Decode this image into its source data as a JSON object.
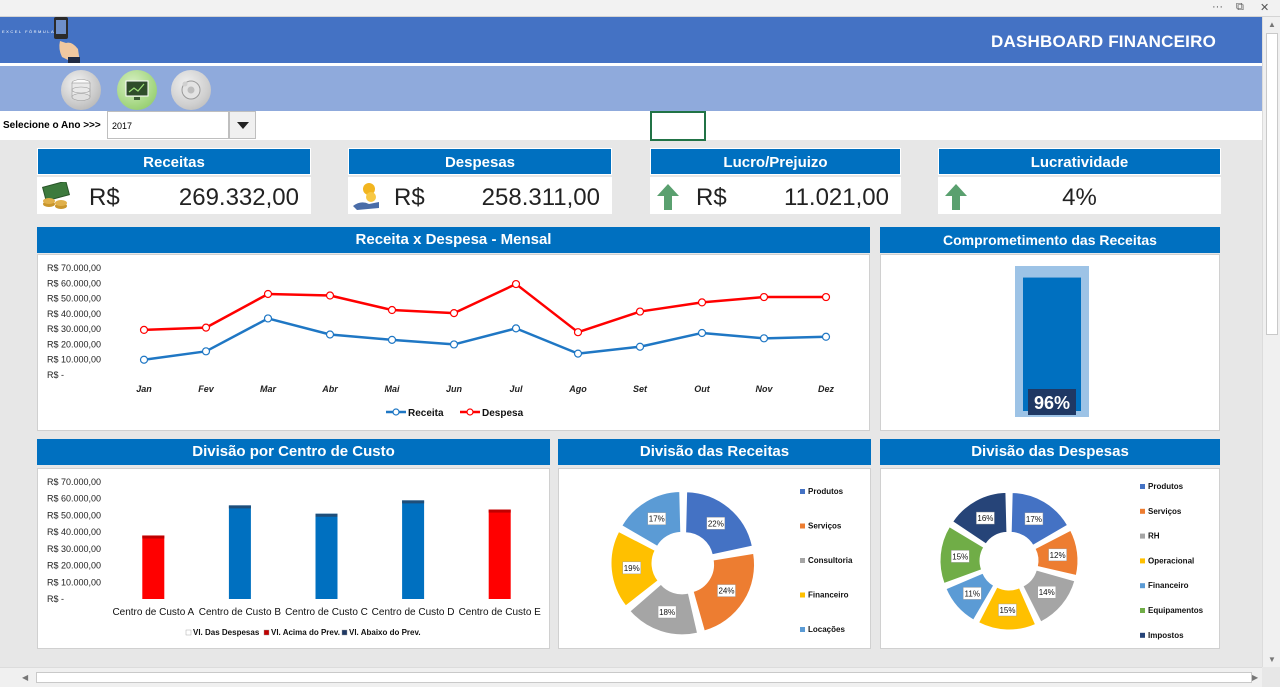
{
  "header": {
    "title": "DASHBOARD FINANCEIRO",
    "logo_text": "EXCEL FÓRMULA"
  },
  "year_filter": {
    "label": "Selecione o Ano >>>",
    "value": "2017"
  },
  "kpis": [
    {
      "title": "Receitas",
      "currency": "R$",
      "value": "269.332,00",
      "icon": "money-stack-icon"
    },
    {
      "title": "Despesas",
      "currency": "R$",
      "value": "258.311,00",
      "icon": "hand-coins-icon"
    },
    {
      "title": "Lucro/Prejuizo",
      "currency": "R$",
      "value": "11.021,00",
      "icon": "arrow-up-icon"
    },
    {
      "title": "Lucratividade",
      "value": "4%",
      "icon": "arrow-up-icon"
    }
  ],
  "colors": {
    "header_blue": "#4472c4",
    "panel_blue": "#0070c0",
    "strip_blue": "#8faadc",
    "receita_line": "#1f77c4",
    "despesa_line": "#ff0000",
    "up_arrow": "#5aa06f"
  },
  "panels": {
    "line_chart_title": "Receita x Despesa - Mensal",
    "gauge_title": "Comprometimento das Receitas",
    "cost_center_title": "Divisão por Centro de Custo",
    "revenue_split_title": "Divisão das Receitas",
    "expense_split_title": "Divisão das Despesas"
  },
  "chart_data": [
    {
      "type": "line",
      "title": "Receita x Despesa - Mensal",
      "x": [
        "Jan",
        "Fev",
        "Mar",
        "Abr",
        "Mai",
        "Jun",
        "Jul",
        "Ago",
        "Set",
        "Out",
        "Nov",
        "Dez"
      ],
      "y_ticks": [
        "R$ 70.000,00",
        "R$ 60.000,00",
        "R$ 50.000,00",
        "R$ 40.000,00",
        "R$ 30.000,00",
        "R$ 20.000,00",
        "R$ 10.000,00",
        "R$ -"
      ],
      "ylim": [
        0,
        70000
      ],
      "legend_position": "bottom",
      "series": [
        {
          "name": "Receita",
          "color": "#1f77c4",
          "values": [
            10000,
            15500,
            37000,
            26500,
            23000,
            20000,
            30500,
            14000,
            18500,
            27500,
            24000,
            25000
          ]
        },
        {
          "name": "Despesa",
          "color": "#ff0000",
          "values": [
            29500,
            31000,
            53000,
            52000,
            42500,
            40500,
            59500,
            28000,
            41500,
            47500,
            51000,
            51000
          ]
        }
      ]
    },
    {
      "type": "bar",
      "title": "Comprometimento das Receitas",
      "value_pct": 96,
      "label": "96%"
    },
    {
      "type": "bar",
      "title": "Divisão por Centro de Custo",
      "categories": [
        "Centro de Custo A",
        "Centro de Custo B",
        "Centro de Custo C",
        "Centro de Custo D",
        "Centro de Custo E"
      ],
      "values": [
        38000,
        56000,
        51000,
        59000,
        53500
      ],
      "colors": [
        "#ff0000",
        "#0070c0",
        "#0070c0",
        "#0070c0",
        "#ff0000"
      ],
      "y_ticks": [
        "R$ 70.000,00",
        "R$ 60.000,00",
        "R$ 50.000,00",
        "R$ 40.000,00",
        "R$ 30.000,00",
        "R$ 20.000,00",
        "R$ 10.000,00",
        "R$ -"
      ],
      "ylim": [
        0,
        70000
      ],
      "legend": [
        {
          "name": "Vl. Das Despesas",
          "color": "#ffffff"
        },
        {
          "name": "Vl. Acima do Prev.",
          "color": "#c00000"
        },
        {
          "name": "Vl. Abaixo do Prev.",
          "color": "#1f3864"
        }
      ]
    },
    {
      "type": "pie",
      "title": "Divisão das Receitas",
      "labels": [
        "Produtos",
        "Serviços",
        "Consultoria",
        "Financeiro",
        "Locações"
      ],
      "values": [
        22,
        24,
        18,
        19,
        17
      ],
      "value_labels": [
        "22%",
        "24%",
        "18%",
        "19%",
        "17%"
      ],
      "colors": [
        "#4472c4",
        "#ed7d31",
        "#a5a5a5",
        "#ffc000",
        "#5b9bd5"
      ]
    },
    {
      "type": "pie",
      "title": "Divisão das Despesas",
      "labels": [
        "Produtos",
        "Serviços",
        "RH",
        "Operacional",
        "Financeiro",
        "Equipamentos",
        "Impostos"
      ],
      "values": [
        17,
        12,
        14,
        15,
        11,
        15,
        16
      ],
      "value_labels": [
        "17%",
        "12%",
        "14%",
        "15%",
        "11%",
        "15%",
        "16%"
      ],
      "colors": [
        "#4472c4",
        "#ed7d31",
        "#a5a5a5",
        "#ffc000",
        "#5b9bd5",
        "#70ad47",
        "#264478"
      ]
    }
  ]
}
